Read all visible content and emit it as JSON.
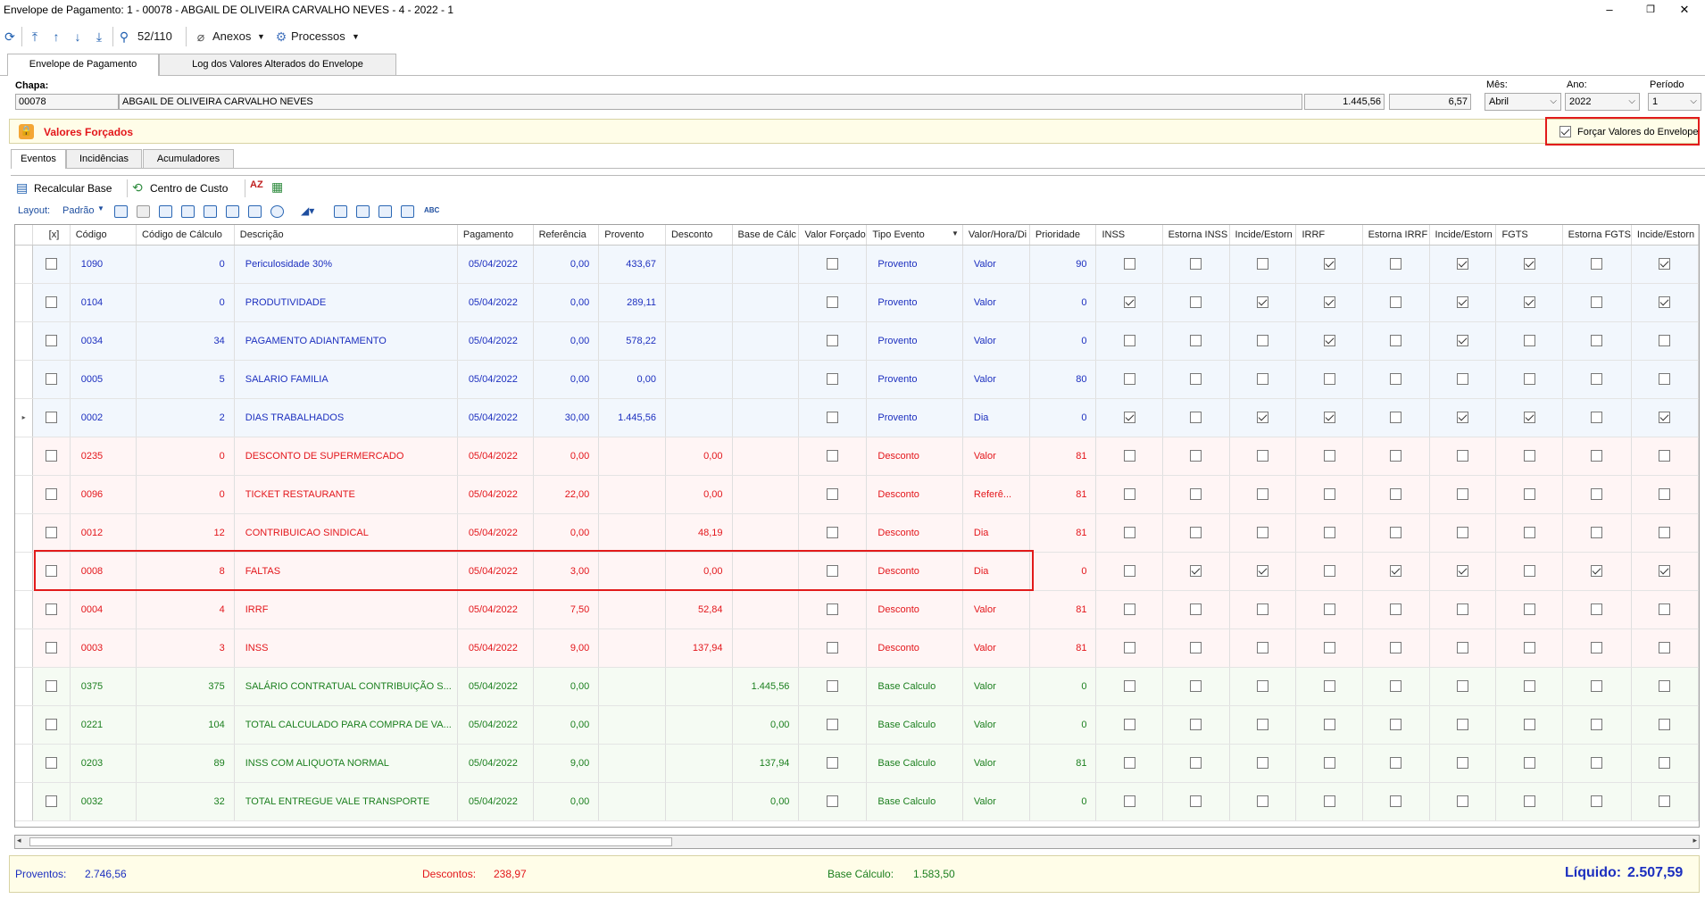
{
  "window": {
    "title": "Envelope de Pagamento: 1 - 00078 - ABGAIL DE OLIVEIRA CARVALHO NEVES - 4 - 2022 - 1",
    "min": "–",
    "restore": "❐",
    "close": "✕"
  },
  "toolbar": {
    "record_position": "52/110",
    "anexos_label": "Anexos",
    "processos_label": "Processos"
  },
  "tabs": [
    {
      "label": "Envelope de Pagamento"
    },
    {
      "label": "Log dos Valores Alterados do Envelope"
    }
  ],
  "header": {
    "chapa_label": "Chapa:",
    "chapa": "00078",
    "nome": "ABGAIL DE OLIVEIRA CARVALHO NEVES",
    "valor1": "1.445,56",
    "valor2": "6,57",
    "mes_label": "Mês:",
    "mes": "Abril",
    "ano_label": "Ano:",
    "ano": "2022",
    "periodo_label": "Período",
    "periodo": "1"
  },
  "forced": {
    "title": "Valores Forçados",
    "checkbox_label": "Forçar Valores do Envelope",
    "checked": true
  },
  "subtabs": [
    {
      "label": "Eventos"
    },
    {
      "label": "Incidências"
    },
    {
      "label": "Acumuladores"
    }
  ],
  "actions": {
    "recalcular": "Recalcular Base",
    "centro": "Centro de Custo"
  },
  "layout": {
    "label": "Layout:",
    "value": "Padrão"
  },
  "columns": [
    "[x]",
    "Código",
    "Código de Cálculo",
    "Descrição",
    "Pagamento",
    "Referência",
    "Provento",
    "Desconto",
    "Base de Cálc",
    "Valor Forçado",
    "Tipo Evento",
    "Valor/Hora/Di",
    "Prioridade",
    "INSS",
    "Estorna INSS",
    "Incide/Estorn",
    "IRRF",
    "Estorna IRRF",
    "Incide/Estorn",
    "FGTS",
    "Estorna FGTS",
    "Incide/Estorn"
  ],
  "rows": [
    {
      "cls": "blue",
      "codigo": "1090",
      "calc": "0",
      "descricao": "Periculosidade 30%",
      "pagamento": "05/04/2022",
      "referencia": "0,00",
      "provento": "433,67",
      "desconto": "",
      "base": "",
      "tipo": "Provento",
      "vhd": "Valor",
      "prioridade": "90",
      "flags": [
        0,
        0,
        0,
        1,
        0,
        1,
        1,
        0,
        1
      ]
    },
    {
      "cls": "blue",
      "codigo": "0104",
      "calc": "0",
      "descricao": "PRODUTIVIDADE",
      "pagamento": "05/04/2022",
      "referencia": "0,00",
      "provento": "289,11",
      "desconto": "",
      "base": "",
      "tipo": "Provento",
      "vhd": "Valor",
      "prioridade": "0",
      "flags": [
        1,
        0,
        1,
        1,
        0,
        1,
        1,
        0,
        1
      ]
    },
    {
      "cls": "blue",
      "codigo": "0034",
      "calc": "34",
      "descricao": "PAGAMENTO ADIANTAMENTO",
      "pagamento": "05/04/2022",
      "referencia": "0,00",
      "provento": "578,22",
      "desconto": "",
      "base": "",
      "tipo": "Provento",
      "vhd": "Valor",
      "prioridade": "0",
      "flags": [
        0,
        0,
        0,
        1,
        0,
        1,
        0,
        0,
        0
      ]
    },
    {
      "cls": "blue",
      "codigo": "0005",
      "calc": "5",
      "descricao": "SALARIO FAMILIA",
      "pagamento": "05/04/2022",
      "referencia": "0,00",
      "provento": "0,00",
      "desconto": "",
      "base": "",
      "tipo": "Provento",
      "vhd": "Valor",
      "prioridade": "80",
      "flags": [
        0,
        0,
        0,
        0,
        0,
        0,
        0,
        0,
        0
      ]
    },
    {
      "cls": "blue",
      "codigo": "0002",
      "calc": "2",
      "descricao": "DIAS TRABALHADOS",
      "pagamento": "05/04/2022",
      "referencia": "30,00",
      "provento": "1.445,56",
      "desconto": "",
      "base": "",
      "tipo": "Provento",
      "vhd": "Dia",
      "prioridade": "0",
      "flags": [
        1,
        0,
        1,
        1,
        0,
        1,
        1,
        0,
        1
      ],
      "current": true
    },
    {
      "cls": "red",
      "codigo": "0235",
      "calc": "0",
      "descricao": "DESCONTO DE SUPERMERCADO",
      "pagamento": "05/04/2022",
      "referencia": "0,00",
      "provento": "",
      "desconto": "0,00",
      "base": "",
      "tipo": "Desconto",
      "vhd": "Valor",
      "prioridade": "81",
      "flags": [
        0,
        0,
        0,
        0,
        0,
        0,
        0,
        0,
        0
      ]
    },
    {
      "cls": "red",
      "codigo": "0096",
      "calc": "0",
      "descricao": "TICKET RESTAURANTE",
      "pagamento": "05/04/2022",
      "referencia": "22,00",
      "provento": "",
      "desconto": "0,00",
      "base": "",
      "tipo": "Desconto",
      "vhd": "Referê...",
      "prioridade": "81",
      "flags": [
        0,
        0,
        0,
        0,
        0,
        0,
        0,
        0,
        0
      ]
    },
    {
      "cls": "red",
      "codigo": "0012",
      "calc": "12",
      "descricao": "CONTRIBUICAO SINDICAL",
      "pagamento": "05/04/2022",
      "referencia": "0,00",
      "provento": "",
      "desconto": "48,19",
      "base": "",
      "tipo": "Desconto",
      "vhd": "Dia",
      "prioridade": "81",
      "flags": [
        0,
        0,
        0,
        0,
        0,
        0,
        0,
        0,
        0
      ]
    },
    {
      "cls": "red",
      "codigo": "0008",
      "calc": "8",
      "descricao": "FALTAS",
      "pagamento": "05/04/2022",
      "referencia": "3,00",
      "provento": "",
      "desconto": "0,00",
      "base": "",
      "tipo": "Desconto",
      "vhd": "Dia",
      "prioridade": "0",
      "flags": [
        0,
        1,
        1,
        0,
        1,
        1,
        0,
        1,
        1
      ]
    },
    {
      "cls": "red",
      "codigo": "0004",
      "calc": "4",
      "descricao": "IRRF",
      "pagamento": "05/04/2022",
      "referencia": "7,50",
      "provento": "",
      "desconto": "52,84",
      "base": "",
      "tipo": "Desconto",
      "vhd": "Valor",
      "prioridade": "81",
      "flags": [
        0,
        0,
        0,
        0,
        0,
        0,
        0,
        0,
        0
      ]
    },
    {
      "cls": "red",
      "codigo": "0003",
      "calc": "3",
      "descricao": "INSS",
      "pagamento": "05/04/2022",
      "referencia": "9,00",
      "provento": "",
      "desconto": "137,94",
      "base": "",
      "tipo": "Desconto",
      "vhd": "Valor",
      "prioridade": "81",
      "flags": [
        0,
        0,
        0,
        0,
        0,
        0,
        0,
        0,
        0
      ]
    },
    {
      "cls": "green",
      "codigo": "0375",
      "calc": "375",
      "descricao": "SALÁRIO CONTRATUAL CONTRIBUIÇÃO S...",
      "pagamento": "05/04/2022",
      "referencia": "0,00",
      "provento": "",
      "desconto": "",
      "base": "1.445,56",
      "tipo": "Base Calculo",
      "vhd": "Valor",
      "prioridade": "0",
      "flags": [
        0,
        0,
        0,
        0,
        0,
        0,
        0,
        0,
        0
      ]
    },
    {
      "cls": "green",
      "codigo": "0221",
      "calc": "104",
      "descricao": "TOTAL CALCULADO PARA COMPRA DE VA...",
      "pagamento": "05/04/2022",
      "referencia": "0,00",
      "provento": "",
      "desconto": "",
      "base": "0,00",
      "tipo": "Base Calculo",
      "vhd": "Valor",
      "prioridade": "0",
      "flags": [
        0,
        0,
        0,
        0,
        0,
        0,
        0,
        0,
        0
      ]
    },
    {
      "cls": "green",
      "codigo": "0203",
      "calc": "89",
      "descricao": "INSS COM ALIQUOTA NORMAL",
      "pagamento": "05/04/2022",
      "referencia": "9,00",
      "provento": "",
      "desconto": "",
      "base": "137,94",
      "tipo": "Base Calculo",
      "vhd": "Valor",
      "prioridade": "81",
      "flags": [
        0,
        0,
        0,
        0,
        0,
        0,
        0,
        0,
        0
      ]
    },
    {
      "cls": "green",
      "codigo": "0032",
      "calc": "32",
      "descricao": "TOTAL ENTREGUE VALE TRANSPORTE",
      "pagamento": "05/04/2022",
      "referencia": "0,00",
      "provento": "",
      "desconto": "",
      "base": "0,00",
      "tipo": "Base Calculo",
      "vhd": "Valor",
      "prioridade": "0",
      "flags": [
        0,
        0,
        0,
        0,
        0,
        0,
        0,
        0,
        0
      ]
    }
  ],
  "footer": {
    "proventos_label": "Proventos:",
    "proventos": "2.746,56",
    "descontos_label": "Descontos:",
    "descontos": "238,97",
    "base_label": "Base Cálculo:",
    "base": "1.583,50",
    "liquido_label": "Líquido:",
    "liquido": "2.507,59"
  },
  "colors": {
    "provento": "#1c2fbf",
    "desconto": "#e3161b",
    "base": "#1b7f1e",
    "highlight": "#e21b1b"
  }
}
